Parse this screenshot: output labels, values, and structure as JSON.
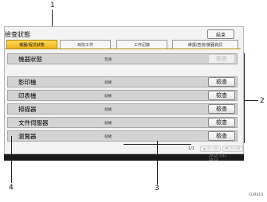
{
  "callouts": {
    "c1": "1",
    "c2": "2",
    "c3": "3",
    "c4": "4"
  },
  "header": {
    "title": "檢查狀態",
    "end_label": "結束"
  },
  "tabs": [
    {
      "label": "機器/程式狀態",
      "active": true
    },
    {
      "label": "目前工作",
      "active": false
    },
    {
      "label": "工作記錄",
      "active": false
    },
    {
      "label": "維護/查詢/機器資訊",
      "active": false
    }
  ],
  "rows": [
    {
      "label": "機器狀態",
      "status": "普通",
      "button": "檢查",
      "button_enabled": false
    },
    {
      "label": "影印機",
      "status": "就緒",
      "button": "檢查",
      "button_enabled": true
    },
    {
      "label": "印表機",
      "status": "就緒",
      "button": "檢查",
      "button_enabled": true
    },
    {
      "label": "掃描器",
      "status": "就緒",
      "button": "檢查",
      "button_enabled": true
    },
    {
      "label": "文件伺服器",
      "status": "就緒",
      "button": "檢查",
      "button_enabled": true
    },
    {
      "label": "瀏覽器",
      "status": "就緒",
      "button": "檢查",
      "button_enabled": true
    }
  ],
  "pager": {
    "text": "1/1",
    "prev_label": "▲ 上一頁",
    "next_label": "▼ 下一頁"
  },
  "clock": {
    "date": "2012/ 1/31",
    "time": "10:12"
  },
  "ref_code": "CUR013",
  "colors": {
    "active_tab": "#f2b31c",
    "row_bg": "#d3d3d3",
    "bottom_bar": "#1a1a1a"
  }
}
